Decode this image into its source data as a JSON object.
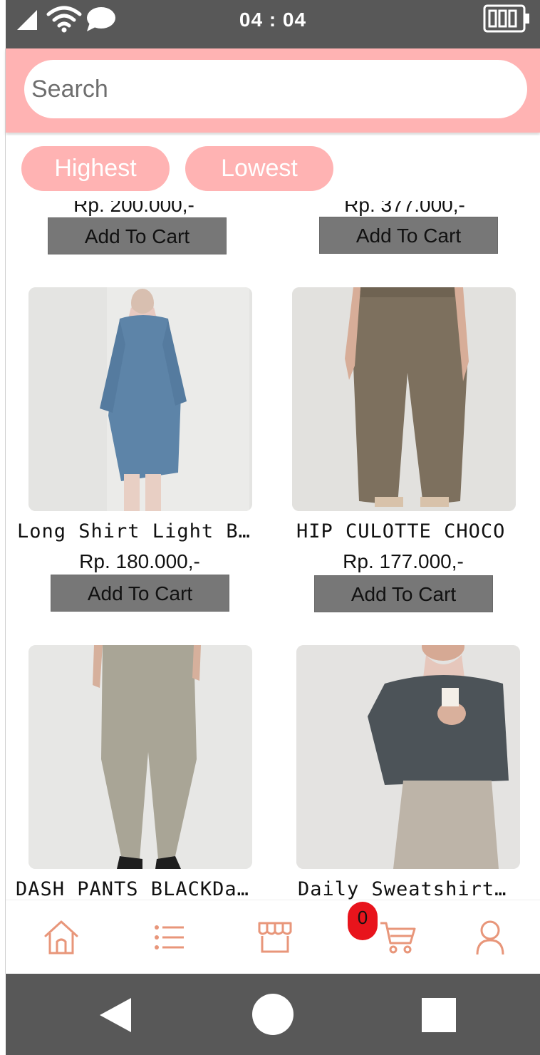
{
  "status_bar": {
    "time": "04 : 04",
    "icons": [
      "signal-icon",
      "wifi-icon",
      "message-bubble-icon",
      "battery-icon"
    ]
  },
  "search": {
    "placeholder": "Search",
    "value": ""
  },
  "sort": {
    "highest_label": "Highest",
    "lowest_label": "Lowest"
  },
  "products": [
    {
      "name": "",
      "price": "Rp. 200.000,-",
      "add_label": "Add To Cart"
    },
    {
      "name": "",
      "price": "Rp. 377.000,-",
      "add_label": "Add To Cart"
    },
    {
      "name": "Long Shirt Light B…",
      "price": "Rp. 180.000,-",
      "add_label": "Add To Cart"
    },
    {
      "name": "HIP CULOTTE CHOCO",
      "price": "Rp. 177.000,-",
      "add_label": "Add To Cart"
    },
    {
      "name": "DASH PANTS BLACKDa…",
      "price": "",
      "add_label": ""
    },
    {
      "name": "Daily Sweatshirt…",
      "price": "",
      "add_label": ""
    }
  ],
  "bottom_nav": {
    "items": [
      "home-icon",
      "list-icon",
      "store-icon",
      "cart-icon",
      "profile-icon"
    ],
    "cart_count": "0"
  },
  "colors": {
    "accent": "#ffb3b3",
    "nav_icon": "#e8967a",
    "badge": "#e8141c",
    "button": "#777777",
    "system_bar": "#585858"
  }
}
